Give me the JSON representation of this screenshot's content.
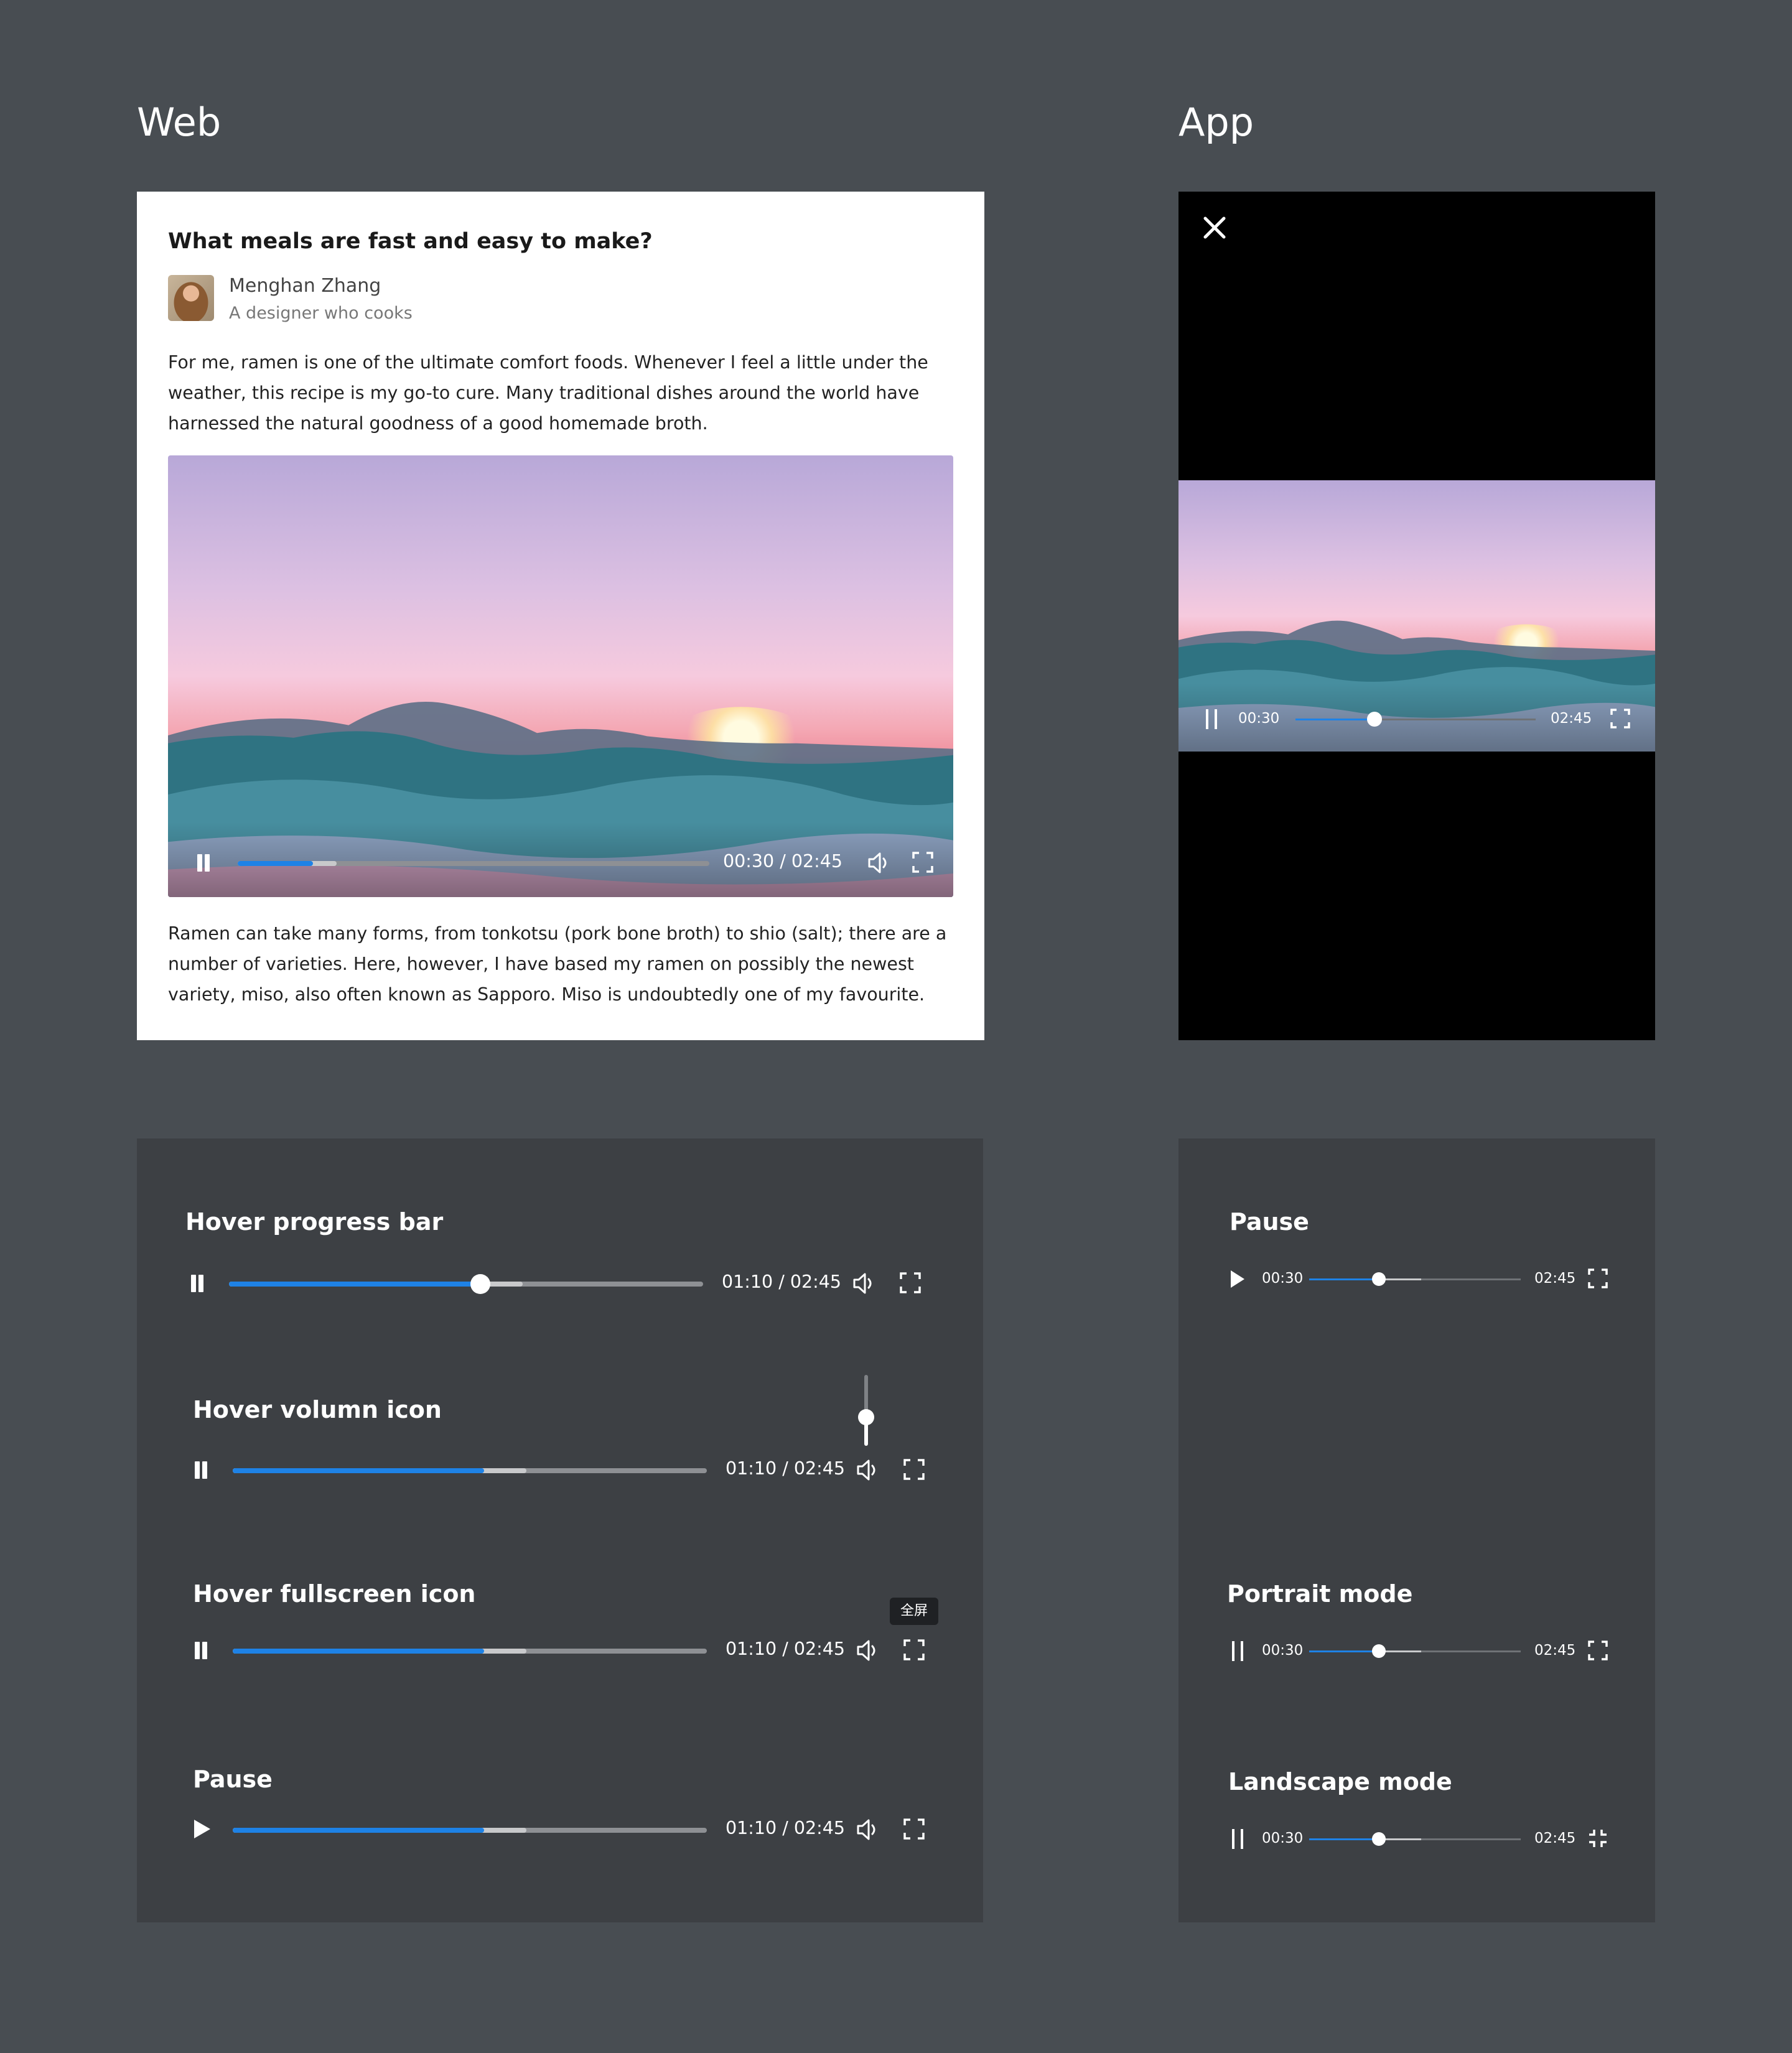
{
  "sections": {
    "web": "Web",
    "app": "App"
  },
  "post": {
    "question": "What meals are fast and easy to make?",
    "author": {
      "name": "Menghan Zhang",
      "description": "A designer who cooks"
    },
    "paragraph1": "For me, ramen is one of the ultimate comfort foods. Whenever I feel a little under the weather, this recipe is my go-to cure. Many traditional dishes around the world have harnessed the natural goodness of a good homemade broth.",
    "paragraph2": "Ramen can take many forms, from tonkotsu (pork bone broth) to shio (salt); there are a number of varieties. Here, however, I have based my ramen on possibly the newest variety, miso, also often known as Sapporo. Miso is undoubtedly one of my favourite."
  },
  "web_player": {
    "time": "00:30 / 02:45",
    "played": 0.16,
    "buffered": 0.21,
    "state": "playing"
  },
  "app_player": {
    "current": "00:30",
    "duration": "02:45",
    "played": 0.33,
    "buffered": 0.33,
    "state": "playing"
  },
  "web_states": [
    {
      "label": "Hover progress bar",
      "time": "01:10 / 02:45",
      "played": 0.53,
      "buffered": 0.62,
      "knob": true,
      "state": "playing"
    },
    {
      "label": "Hover volumn icon",
      "time": "01:10 / 02:45",
      "played": 0.53,
      "buffered": 0.62,
      "knob": false,
      "state": "playing",
      "volume": 0.4
    },
    {
      "label": "Hover fullscreen icon",
      "time": "01:10 / 02:45",
      "played": 0.53,
      "buffered": 0.62,
      "knob": false,
      "state": "playing",
      "tooltip": "全屏"
    },
    {
      "label": "Pause",
      "time": "01:10 / 02:45",
      "played": 0.53,
      "buffered": 0.62,
      "knob": false,
      "state": "paused"
    }
  ],
  "app_states": [
    {
      "label": "Pause",
      "current": "00:30",
      "duration": "02:45",
      "played": 0.33,
      "buffered": 0.53,
      "state": "paused",
      "fullscreen": "enter"
    },
    {
      "label": "Portrait mode",
      "current": "00:30",
      "duration": "02:45",
      "played": 0.33,
      "buffered": 0.53,
      "state": "playing",
      "fullscreen": "enter"
    },
    {
      "label": "Landscape mode",
      "current": "00:30",
      "duration": "02:45",
      "played": 0.33,
      "buffered": 0.53,
      "state": "playing",
      "fullscreen": "exit"
    }
  ],
  "icons": {
    "pause": "pause-icon",
    "play": "play-icon",
    "volume": "volume-icon",
    "fullscreen": "fullscreen-icon",
    "exit_fullscreen": "exit-fullscreen-icon",
    "close": "close-icon"
  },
  "colors": {
    "accent": "#1e82e6",
    "background": "#484d52",
    "panel": "#3d4044"
  }
}
